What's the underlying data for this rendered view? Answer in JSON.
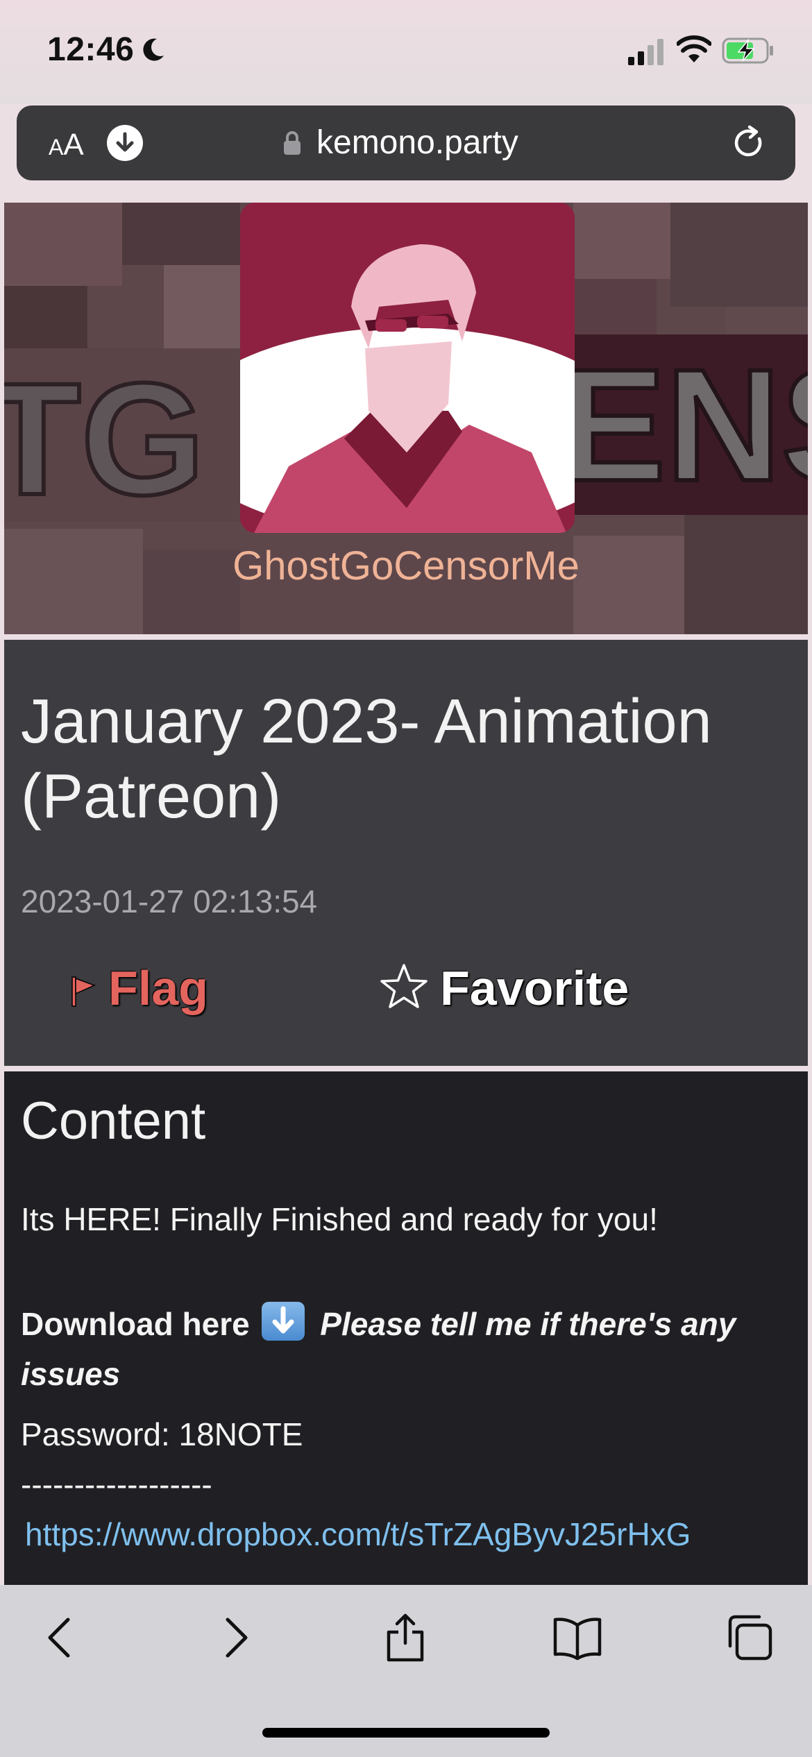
{
  "status": {
    "time": "12:46"
  },
  "browser": {
    "text_size_label_small": "A",
    "text_size_label_large": "A",
    "url": "kemono.party"
  },
  "creator": {
    "name": "GhostGoCensorMe",
    "banner_text": "TGO ENS"
  },
  "post": {
    "title": "January 2023- Animation (Patreon)",
    "date": "2023-01-27 02:13:54",
    "flag_label": "Flag",
    "favorite_label": "Favorite"
  },
  "content": {
    "heading": "Content",
    "line1": "Its HERE! Finally Finished and ready for you!",
    "download_label": "Download here",
    "issues_text": "Please tell me if there's any issues",
    "password": "Password: 18NOTE",
    "separator": "------------------",
    "link": "https://www.dropbox.com/t/sTrZAgByvJ25rHxG"
  },
  "colors": {
    "flag": "#e4645e",
    "link": "#7fc0ee",
    "creator_name": "#f0b396"
  }
}
